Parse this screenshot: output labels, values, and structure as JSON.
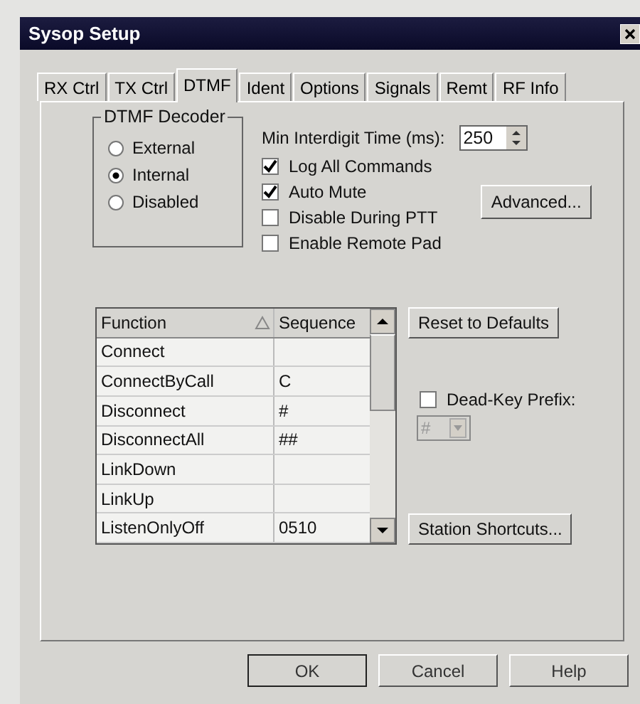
{
  "window": {
    "title": "Sysop Setup"
  },
  "tabs": [
    {
      "label": "RX Ctrl",
      "selected": false
    },
    {
      "label": "TX Ctrl",
      "selected": false
    },
    {
      "label": "DTMF",
      "selected": true
    },
    {
      "label": "Ident",
      "selected": false
    },
    {
      "label": "Options",
      "selected": false
    },
    {
      "label": "Signals",
      "selected": false
    },
    {
      "label": "Remt",
      "selected": false
    },
    {
      "label": "RF Info",
      "selected": false
    }
  ],
  "dtmf_decoder": {
    "title": "DTMF Decoder",
    "options": [
      {
        "label": "External",
        "selected": false
      },
      {
        "label": "Internal",
        "selected": true
      },
      {
        "label": "Disabled",
        "selected": false
      }
    ]
  },
  "min_interdigit": {
    "label": "Min Interdigit Time (ms):",
    "value": "250"
  },
  "checkboxes": [
    {
      "label": "Log All Commands",
      "checked": true
    },
    {
      "label": "Auto Mute",
      "checked": true
    },
    {
      "label": "Disable During PTT",
      "checked": false
    },
    {
      "label": "Enable Remote Pad",
      "checked": false
    }
  ],
  "advanced_button": "Advanced...",
  "table": {
    "columns": [
      "Function",
      "Sequence"
    ],
    "rows": [
      [
        "Connect",
        ""
      ],
      [
        "ConnectByCall",
        "C"
      ],
      [
        "Disconnect",
        "#"
      ],
      [
        "DisconnectAll",
        "##"
      ],
      [
        "LinkDown",
        ""
      ],
      [
        "LinkUp",
        ""
      ],
      [
        "ListenOnlyOff",
        "0510"
      ]
    ]
  },
  "reset_button": "Reset to Defaults",
  "dead_key": {
    "label": "Dead-Key Prefix:",
    "checked": false,
    "value": "#",
    "disabled": true
  },
  "station_shortcuts_button": "Station Shortcuts...",
  "buttons": [
    {
      "label": "OK",
      "default": true
    },
    {
      "label": "Cancel",
      "default": false
    },
    {
      "label": "Help",
      "default": false
    }
  ]
}
